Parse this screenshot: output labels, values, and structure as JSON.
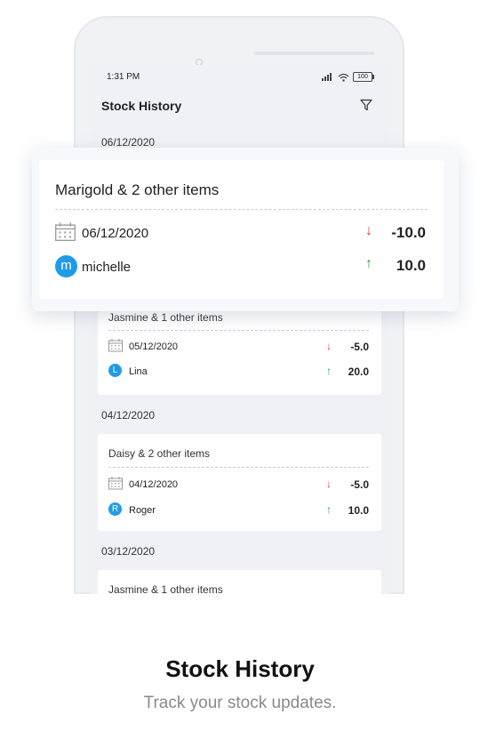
{
  "status": {
    "time": "1:31 PM",
    "battery": "100"
  },
  "appbar": {
    "title": "Stock History",
    "filter_icon": "filter-icon"
  },
  "highlight": {
    "name": "Marigold & 2 other items",
    "date": "06/12/2020",
    "user_initial": "m",
    "user": "michelle",
    "out_value": "-10.0",
    "in_value": "10.0"
  },
  "groups": [
    {
      "date": "06/12/2020"
    },
    {
      "date": "04/12/2020"
    },
    {
      "date": "03/12/2020"
    }
  ],
  "cards": [
    {
      "name": "Jasmine & 1 other items",
      "date": "05/12/2020",
      "user_initial": "L",
      "user": "Lina",
      "out_value": "-5.0",
      "in_value": "20.0"
    },
    {
      "name": "Daisy & 2 other items",
      "date": "04/12/2020",
      "user_initial": "R",
      "user": "Roger",
      "out_value": "-5.0",
      "in_value": "10.0"
    },
    {
      "name": "Jasmine & 1 other items"
    }
  ],
  "caption": {
    "title": "Stock History",
    "subtitle": "Track your stock updates."
  },
  "colors": {
    "down": "#e53935",
    "up": "#2e9e3e",
    "avatar": "#1f9be8",
    "background": "#f0f1f6"
  }
}
